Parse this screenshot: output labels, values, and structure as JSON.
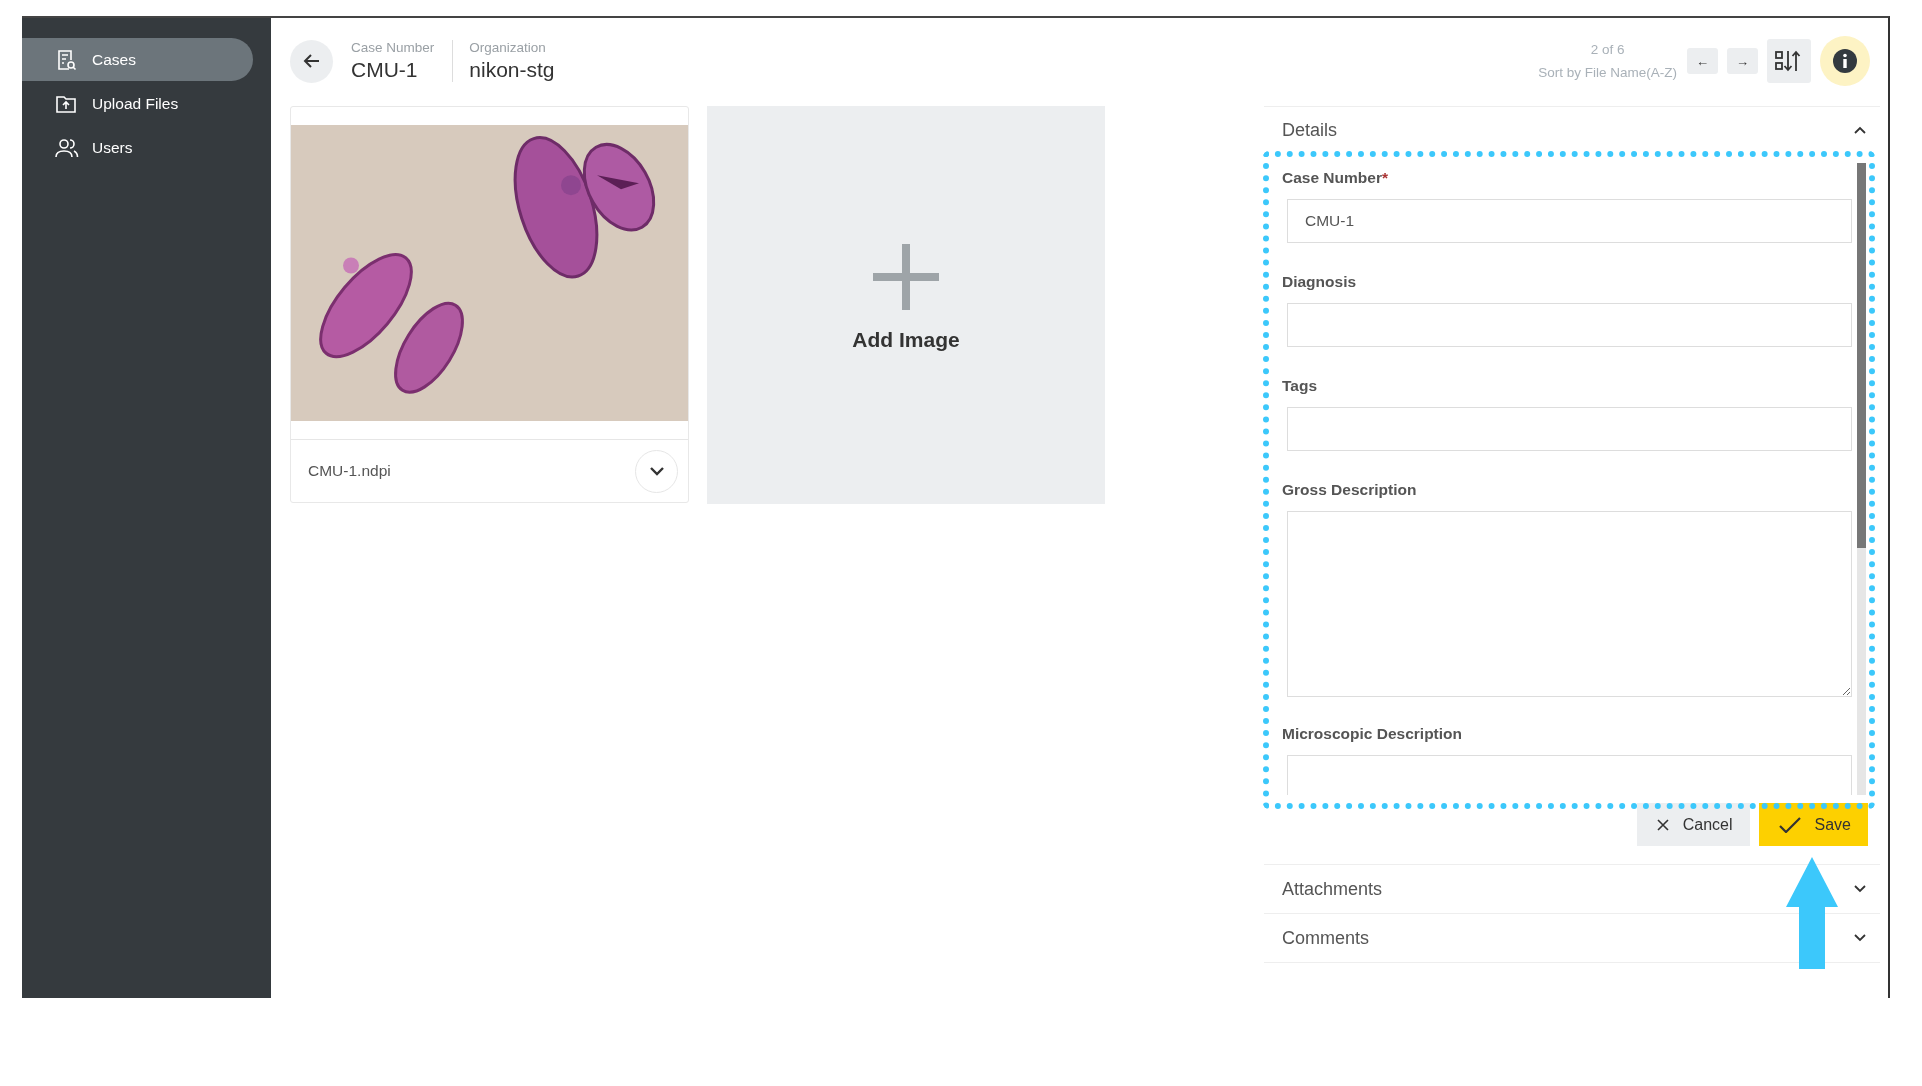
{
  "sidebar": {
    "items": [
      {
        "label": "Cases",
        "selected": true
      },
      {
        "label": "Upload Files",
        "selected": false
      },
      {
        "label": "Users",
        "selected": false
      }
    ]
  },
  "header": {
    "fields": [
      {
        "label": "Case Number",
        "value": "CMU-1"
      },
      {
        "label": "Organization",
        "value": "nikon-stg"
      }
    ],
    "position": "2 of 6",
    "sort": "Sort by File Name(A-Z)",
    "prev": "←",
    "next": "→"
  },
  "images": [
    {
      "kind": "picture",
      "file": "CMU-1.ndpi"
    }
  ],
  "add_image": {
    "label": "Add Image"
  },
  "details": {
    "title": "Details",
    "expanded": true,
    "fields": [
      {
        "label": "Case Number",
        "required_mark": "*",
        "kind": "input",
        "value": "CMU-1"
      },
      {
        "label": "Diagnosis",
        "kind": "input"
      },
      {
        "label": "Tags",
        "kind": "input"
      },
      {
        "label": "Gross Description",
        "kind": "textarea"
      },
      {
        "label": "Microscopic Description",
        "kind": "textarea"
      }
    ],
    "actions": [
      {
        "label": "Cancel",
        "kind": "cancel"
      },
      {
        "label": "Save",
        "kind": "save"
      }
    ]
  },
  "sections": [
    {
      "title": "Attachments",
      "expanded": false
    },
    {
      "title": "Comments",
      "expanded": false
    }
  ]
}
